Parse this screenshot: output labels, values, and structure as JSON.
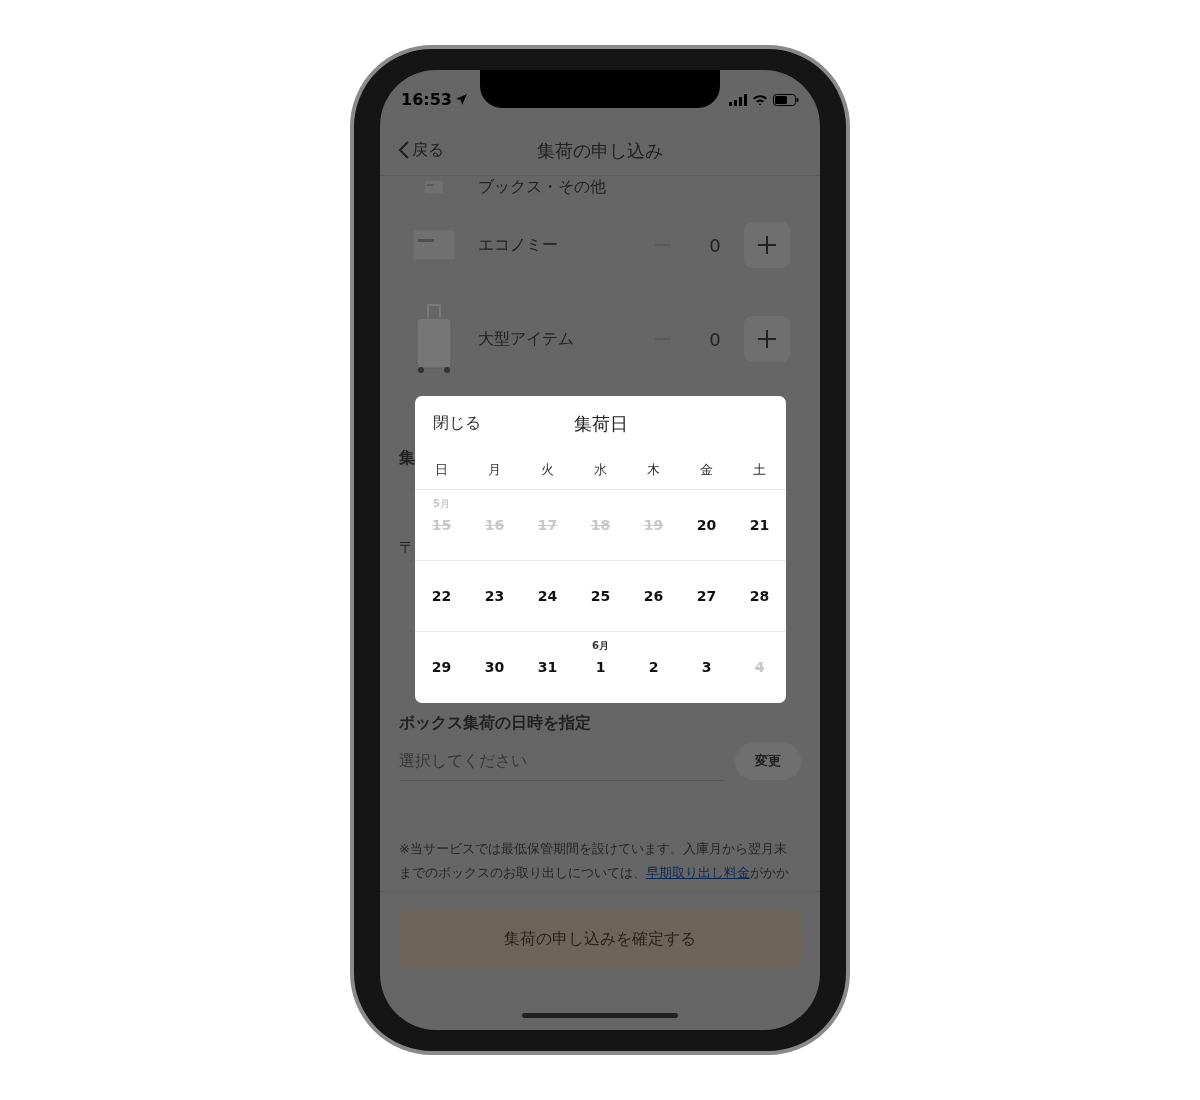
{
  "status_bar": {
    "time": "16:53"
  },
  "header": {
    "back": "戻る",
    "title": "集荷の申し込み"
  },
  "items": [
    {
      "kind": "box",
      "name": "ブックス・その他"
    },
    {
      "kind": "box",
      "name": "エコノミー",
      "count": "0"
    },
    {
      "kind": "suitcase",
      "name": "大型アイテム",
      "count": "0"
    }
  ],
  "hidden_labels": [
    {
      "kind": "heading",
      "text": "集"
    },
    {
      "kind": "field",
      "text": "〒"
    }
  ],
  "schedule": {
    "heading": "ボックス集荷の日時を指定",
    "placeholder": "選択してください",
    "change_button": "変更"
  },
  "note": {
    "line1": "※当サービスでは最低保管期間を設けています。入庫月から翌月末",
    "line2_before": "までのボックスのお取り出しについては、",
    "link": "早期取り出し料金",
    "line2_after": "がかか"
  },
  "submit": {
    "label": "集荷の申し込みを確定する",
    "disabled": true
  },
  "calendar": {
    "close": "閉じる",
    "title": "集荷日",
    "weekdays": [
      "日",
      "月",
      "火",
      "水",
      "木",
      "金",
      "土"
    ],
    "weeks": [
      [
        {
          "day": "15",
          "month": "5月",
          "disabled": true
        },
        {
          "day": "16",
          "disabled": true
        },
        {
          "day": "17",
          "disabled": true
        },
        {
          "day": "18",
          "disabled": true
        },
        {
          "day": "19",
          "disabled": true
        },
        {
          "day": "20",
          "disabled": false
        },
        {
          "day": "21",
          "disabled": false
        }
      ],
      [
        {
          "day": "22",
          "disabled": false
        },
        {
          "day": "23",
          "disabled": false
        },
        {
          "day": "24",
          "disabled": false
        },
        {
          "day": "25",
          "disabled": false
        },
        {
          "day": "26",
          "disabled": false
        },
        {
          "day": "27",
          "disabled": false
        },
        {
          "day": "28",
          "disabled": false
        }
      ],
      [
        {
          "day": "29",
          "disabled": false
        },
        {
          "day": "30",
          "disabled": false
        },
        {
          "day": "31",
          "disabled": false
        },
        {
          "day": "1",
          "month": "6月",
          "disabled": false
        },
        {
          "day": "2",
          "disabled": false
        },
        {
          "day": "3",
          "disabled": false
        },
        {
          "day": "4",
          "disabled": true
        }
      ]
    ]
  }
}
